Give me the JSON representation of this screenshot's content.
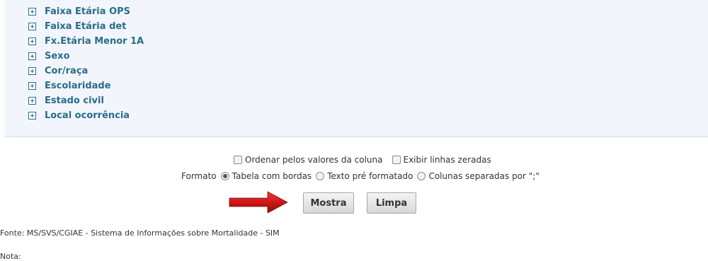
{
  "tree": {
    "items": [
      {
        "label": "Faixa Etária OPS"
      },
      {
        "label": "Faixa Etária det"
      },
      {
        "label": "Fx.Etária Menor 1A"
      },
      {
        "label": "Sexo"
      },
      {
        "label": "Cor/raça"
      },
      {
        "label": "Escolaridade"
      },
      {
        "label": "Estado civil"
      },
      {
        "label": "Local ocorrência"
      }
    ]
  },
  "options": {
    "ordenar_label": "Ordenar pelos valores da coluna",
    "ordenar_checked": false,
    "exibir_label": "Exibir linhas zeradas",
    "exibir_checked": false
  },
  "formato": {
    "label": "Formato",
    "selected": "Tabela com bordas",
    "options": [
      "Tabela com bordas",
      "Texto pré formatado",
      "Colunas separadas por \";\""
    ]
  },
  "buttons": {
    "mostra": "Mostra",
    "limpa": "Limpa"
  },
  "colors": {
    "accent": "#2a6c89",
    "panel": "#f2f6fc",
    "arrow": "#d01818"
  },
  "footer": {
    "fonte": "Fonte: MS/SVS/CGIAE - Sistema de Informações sobre Mortalidade - SIM",
    "nota": "Nota:"
  }
}
